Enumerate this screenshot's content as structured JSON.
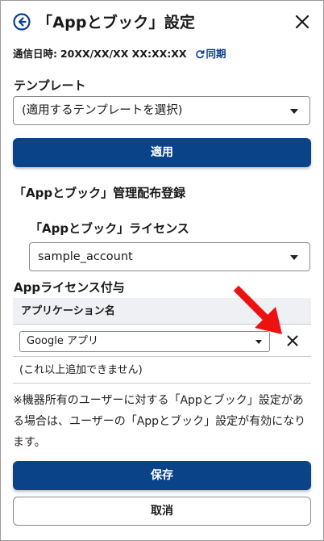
{
  "header": {
    "title": "「Appとブック」設定",
    "back_icon": "arrow-left-circle-icon",
    "close_icon": "close-icon"
  },
  "sync": {
    "label": "通信日時:",
    "value": "20XX/XX/XX XX:XX:XX",
    "link_label": "同期",
    "link_icon": "refresh-icon"
  },
  "template": {
    "label": "テンプレート",
    "selected": "(適用するテンプレートを選択)",
    "apply_label": "適用"
  },
  "managed_dist": {
    "label": "「Appとブック」管理配布登録",
    "license_label": "「Appとブック」ライセンス",
    "license_selected": "sample_account"
  },
  "app_license": {
    "label": "Appライセンス付与",
    "column_header": "アプリケーション名",
    "rows": [
      {
        "app": "Google アプリ"
      }
    ],
    "no_more_text": "(これ以上追加できません)"
  },
  "note": "※機器所有のユーザーに対する「Appとブック」設定がある場合は、ユーザーの「Appとブック」設定が有効になります。",
  "footer": {
    "save_label": "保存",
    "cancel_label": "取消"
  },
  "colors": {
    "primary": "#0b4389",
    "link": "#0b3d91",
    "annotation_arrow": "#ee1111"
  }
}
